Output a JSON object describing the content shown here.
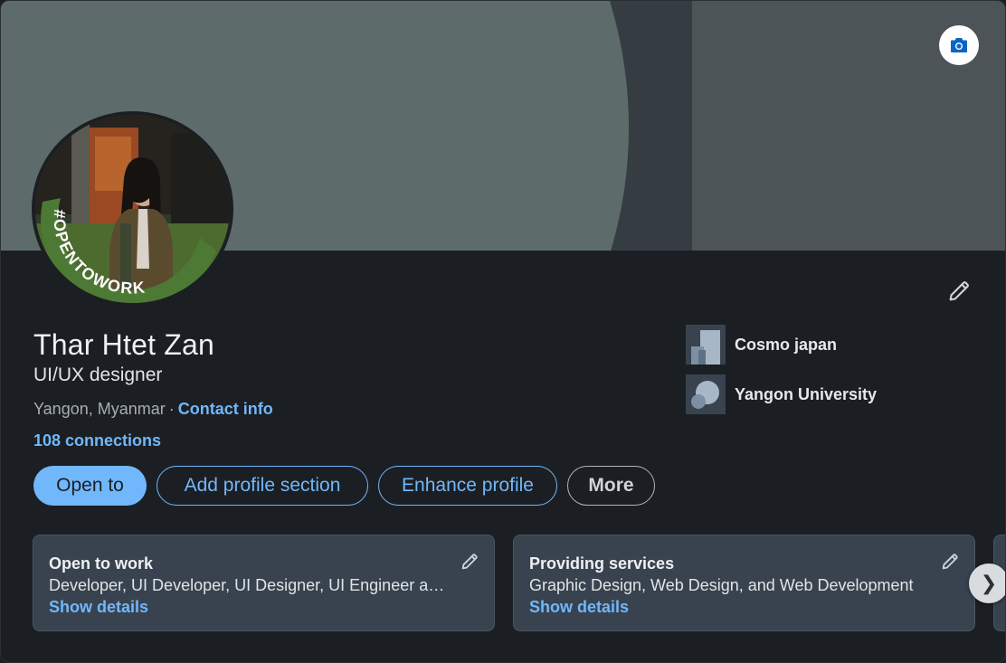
{
  "profile": {
    "name": "Thar Htet Zan",
    "headline": "UI/UX designer",
    "location": "Yangon, Myanmar",
    "separator": "·",
    "contact_info_label": "Contact info",
    "connections_label": "108 connections",
    "frame_badge": "#OPENTOWORK"
  },
  "organizations": [
    {
      "name": "Cosmo japan"
    },
    {
      "name": "Yangon University"
    }
  ],
  "actions": {
    "open_to": "Open to",
    "add_section": "Add profile section",
    "enhance": "Enhance profile",
    "more": "More"
  },
  "cards": [
    {
      "title": "Open to work",
      "description": "Developer, UI Developer, UI Designer, UI Engineer and Web Designer roles",
      "link": "Show details"
    },
    {
      "title": "Providing services",
      "description": "Graphic Design, Web Design, and Web Development",
      "link": "Show details"
    }
  ],
  "carousel": {
    "next_glyph": "❯"
  },
  "colors": {
    "accent": "#71b7fb",
    "badge_green": "#4c7a34",
    "surface": "#1b1f23",
    "card": "#38434f"
  },
  "icons": {
    "banner_camera": "camera-icon",
    "edit": "pencil-icon",
    "next": "chevron-right-icon"
  }
}
